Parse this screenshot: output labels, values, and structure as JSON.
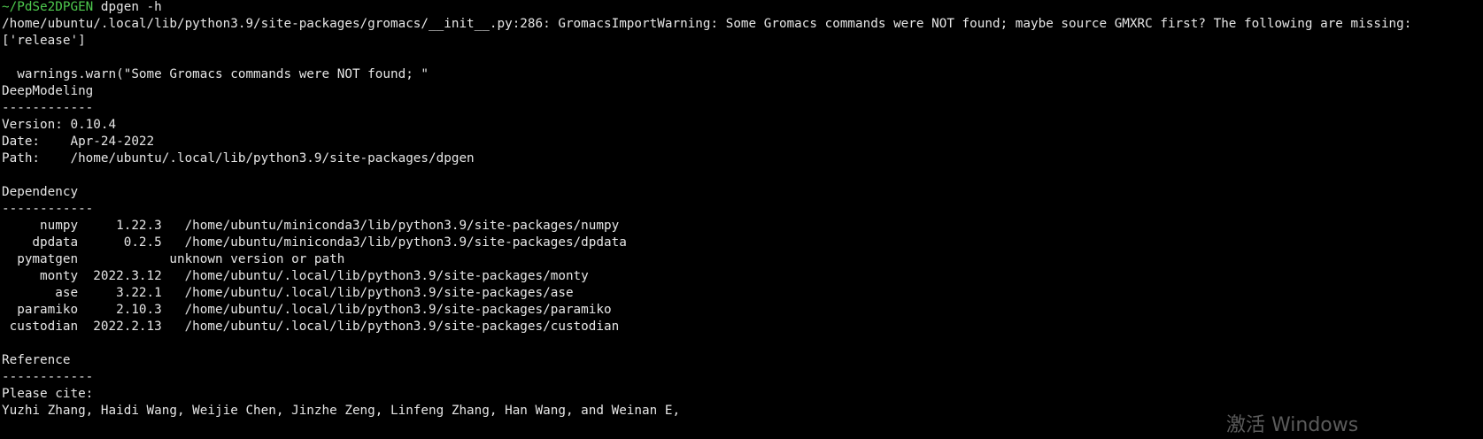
{
  "terminal": {
    "prompt_path": "~/PdSe2DPGEN",
    "command": " dpgen -h",
    "lines": [
      "/home/ubuntu/.local/lib/python3.9/site-packages/gromacs/__init__.py:286: GromacsImportWarning: Some Gromacs commands were NOT found; maybe source GMXRC first? The following are missing:",
      "['release']",
      "",
      "  warnings.warn(\"Some Gromacs commands were NOT found; \"",
      "DeepModeling",
      "------------",
      "Version: 0.10.4",
      "Date:    Apr-24-2022",
      "Path:    /home/ubuntu/.local/lib/python3.9/site-packages/dpgen",
      "",
      "Dependency",
      "------------",
      "     numpy     1.22.3   /home/ubuntu/miniconda3/lib/python3.9/site-packages/numpy",
      "    dpdata      0.2.5   /home/ubuntu/miniconda3/lib/python3.9/site-packages/dpdata",
      "  pymatgen            unknown version or path",
      "     monty  2022.3.12   /home/ubuntu/.local/lib/python3.9/site-packages/monty",
      "       ase     3.22.1   /home/ubuntu/.local/lib/python3.9/site-packages/ase",
      "  paramiko     2.10.3   /home/ubuntu/.local/lib/python3.9/site-packages/paramiko",
      " custodian  2022.2.13   /home/ubuntu/.local/lib/python3.9/site-packages/custodian",
      "",
      "Reference",
      "------------",
      "Please cite:",
      "Yuzhi Zhang, Haidi Wang, Weijie Chen, Jinzhe Zeng, Linfeng Zhang, Han Wang, and Weinan E,"
    ]
  },
  "overlay": {
    "watermark_text": "激活 Windows"
  },
  "colors": {
    "background": "#000000",
    "foreground": "#e6e6e6",
    "prompt": "#4ec94e"
  }
}
